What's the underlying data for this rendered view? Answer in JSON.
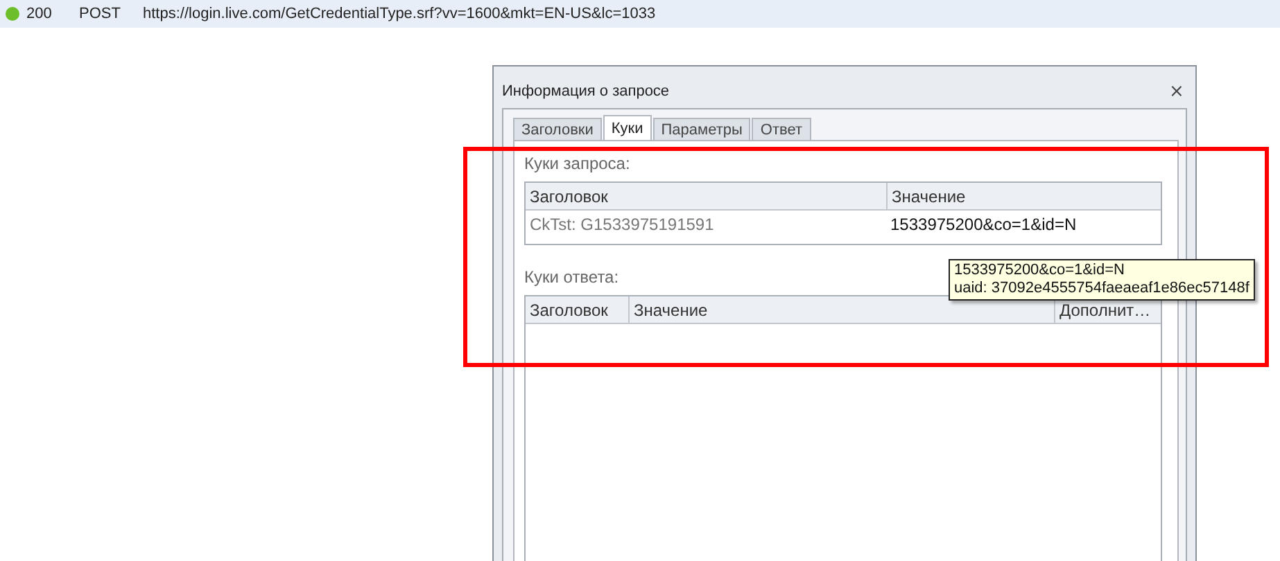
{
  "request_row": {
    "status": "200",
    "method": "POST",
    "url": "https://login.live.com/GetCredentialType.srf?vv=1600&mkt=EN-US&lc=1033"
  },
  "dialog": {
    "title": "Информация о запросе",
    "close": "⨯",
    "tabs": [
      {
        "label": "Заголовки",
        "selected": false
      },
      {
        "label": "Куки",
        "selected": true
      },
      {
        "label": "Параметры",
        "selected": false
      },
      {
        "label": "Ответ",
        "selected": false
      }
    ],
    "request_cookies": {
      "label": "Куки запроса:",
      "columns": [
        "Заголовок",
        "Значение"
      ],
      "rows": [
        [
          "CkTst: G1533975191591",
          "1533975200&co=1&id=N"
        ]
      ]
    },
    "response_cookies": {
      "label": "Куки ответа:",
      "columns": [
        "Заголовок",
        "Значение",
        "Дополнит…"
      ]
    },
    "tooltip": [
      "1533975200&co=1&id=N",
      "uaid: 37092e4555754faeaeaf1e86ec57148f"
    ]
  }
}
